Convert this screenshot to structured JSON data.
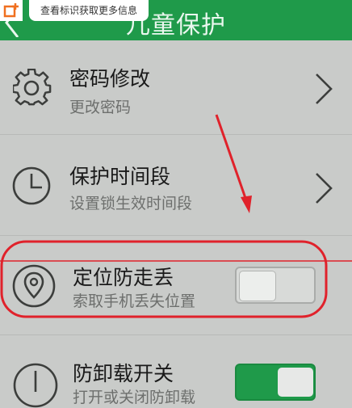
{
  "tip": {
    "text": "查看标识获取更多信息"
  },
  "header": {
    "title": "儿童保护"
  },
  "rows": [
    {
      "title": "密码修改",
      "subtitle": "更改密码",
      "icon": "gear-icon",
      "control": "chevron"
    },
    {
      "title": "保护时间段",
      "subtitle": "设置锁生效时间段",
      "icon": "clock-icon",
      "control": "chevron"
    },
    {
      "title": "定位防走丢",
      "subtitle": "索取手机丢失位置",
      "icon": "location-pin-icon",
      "control": "toggle",
      "toggle_on": false
    },
    {
      "title": "防卸载开关",
      "subtitle": "打开或关闭防卸载",
      "icon": "power-icon",
      "control": "toggle",
      "toggle_on": true
    }
  ],
  "colors": {
    "header_green": "#1f9a4a",
    "annotation_red": "#e0222b",
    "background": "#c9cbc9"
  }
}
